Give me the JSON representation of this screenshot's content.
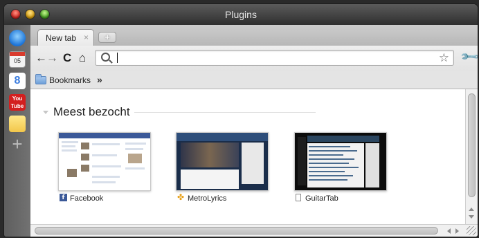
{
  "window": {
    "title": "Plugins"
  },
  "dock": {
    "items": [
      {
        "name": "chrome-icon"
      },
      {
        "name": "calendar-icon",
        "text": "05"
      },
      {
        "name": "google-icon",
        "text": "8"
      },
      {
        "name": "youtube-icon",
        "text": "You Tube"
      },
      {
        "name": "notes-icon"
      },
      {
        "name": "add-icon",
        "text": "+"
      }
    ]
  },
  "tabs": {
    "active": {
      "label": "New tab",
      "close": "×"
    },
    "new_tab": "+"
  },
  "toolbar": {
    "back": "←",
    "forward": "→",
    "reload": "C",
    "home": "⌂",
    "omnibox": {
      "value": "",
      "placeholder": ""
    },
    "star": "☆",
    "wrench": "🔧"
  },
  "bookmarks": {
    "folder_label": "Bookmarks",
    "more": "»"
  },
  "main": {
    "section_title": "Meest bezocht",
    "sites": [
      {
        "label": "Facebook",
        "icon": "f"
      },
      {
        "label": "MetroLyrics",
        "icon": "✤"
      },
      {
        "label": "GuitarTab",
        "icon": ""
      }
    ]
  },
  "colors": {
    "facebook": "#3b5998",
    "metrolyrics": "#e8a21c",
    "titlebar": "#3a3a3a",
    "dock": "#6d6d6d"
  }
}
